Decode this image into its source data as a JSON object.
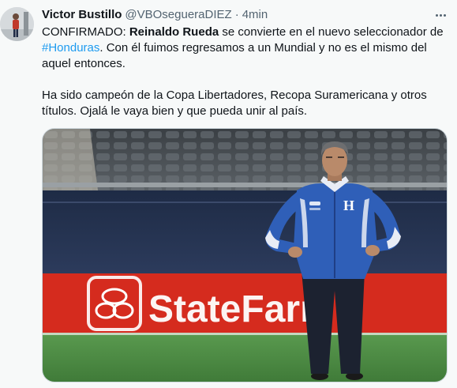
{
  "user": {
    "name": "Victor Bustillo",
    "handle": "@VBOsegueraDIEZ",
    "separator": "·",
    "time": "4min"
  },
  "icons": {
    "avatar": "avatar-photo",
    "more": "more-options-icon"
  },
  "tweet": {
    "p1_part1": "CONFIRMADO: ",
    "p1_bold": "Reinaldo Rueda",
    "p1_part2": " se convierte en el nuevo seleccionador de ",
    "p1_hashtag": "#Honduras",
    "p1_part3": ". Con él fuimos regresamos a un Mundial y no es el mismo del aquel entonces.",
    "p2": "Ha sido campeón de la Copa Libertadores, Recopa Suramericana y otros títulos. Ojalá le vaya bien y que pueda unir al país."
  },
  "media": {
    "ad_board_text": "StateFarm",
    "jacket_crest": "H",
    "colors": {
      "pitch": "#4e8a44",
      "ad_board": "#d52b1e",
      "jacket": "#2f5fb8"
    }
  },
  "colors": {
    "background": "#f7f9f9",
    "text": "#0f1419",
    "secondary": "#536471",
    "link": "#1d9bf0"
  }
}
